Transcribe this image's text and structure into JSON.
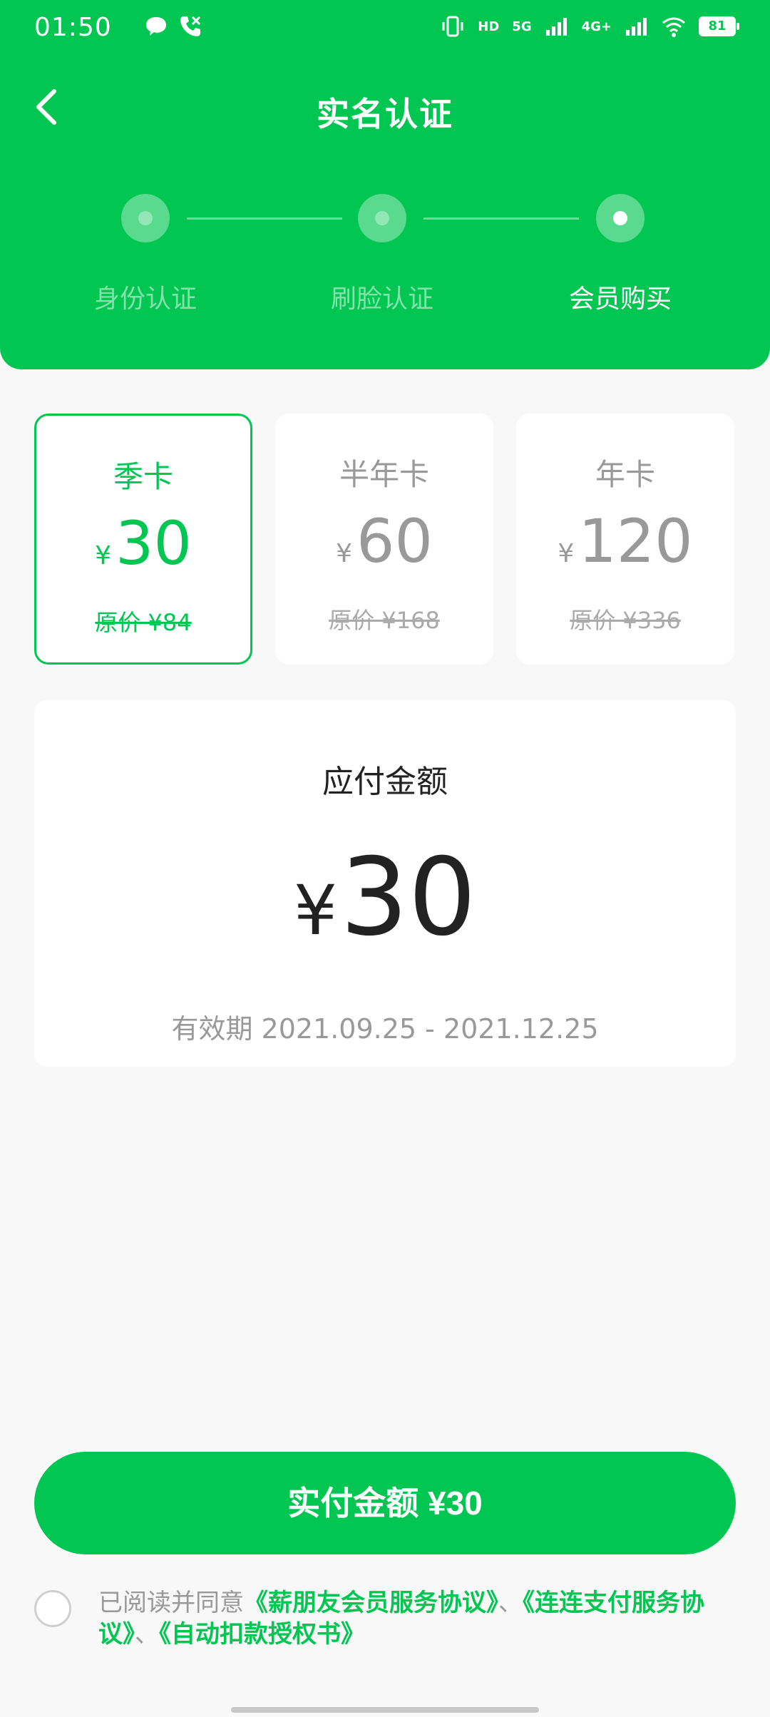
{
  "status_bar": {
    "time": "01:50",
    "battery": "81",
    "hd_label": "HD",
    "net1": "5G",
    "net2": "4G+"
  },
  "nav": {
    "title": "实名认证",
    "back_icon": "chevron-left-icon"
  },
  "steps": [
    {
      "label": "身份认证",
      "active": false
    },
    {
      "label": "刷脸认证",
      "active": false
    },
    {
      "label": "会员购买",
      "active": true
    }
  ],
  "plans": [
    {
      "name": "季卡",
      "yen": "¥",
      "price": "30",
      "original": "原价 ¥84",
      "selected": true
    },
    {
      "name": "半年卡",
      "yen": "¥",
      "price": "60",
      "original": "原价 ¥168",
      "selected": false
    },
    {
      "name": "年卡",
      "yen": "¥",
      "price": "120",
      "original": "原价 ¥336",
      "selected": false
    }
  ],
  "amount": {
    "label": "应付金额",
    "yen": "¥",
    "value": "30",
    "validity": "有效期 2021.09.25 - 2021.12.25"
  },
  "pay_button": {
    "label": "实付金额 ¥30"
  },
  "agreement": {
    "prefix": "已阅读并同意",
    "link1": "《薪朋友会员服务协议》",
    "sep1": "、",
    "link2": "《连连支付服务协议》",
    "sep2": "、",
    "link3": "《自动扣款授权书》"
  },
  "colors": {
    "brand_green": "#02c652",
    "background": "#f8f8f8",
    "muted_text": "#999999"
  }
}
